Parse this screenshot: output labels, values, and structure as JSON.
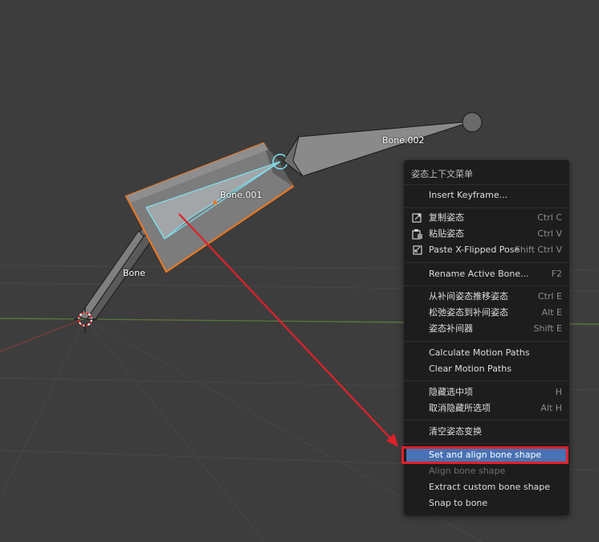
{
  "viewport": {
    "bones": [
      {
        "label": "Bone"
      },
      {
        "label": "Bone.001"
      },
      {
        "label": "Bone.002"
      }
    ]
  },
  "menu": {
    "title": "姿态上下文菜单",
    "items": [
      {
        "label": "Insert Keyframe...",
        "shortcut": "",
        "icon": ""
      },
      {
        "label": "复制姿态",
        "shortcut": "Ctrl C",
        "icon": "copy-pose-icon"
      },
      {
        "label": "粘贴姿态",
        "shortcut": "Ctrl V",
        "icon": "paste-pose-icon"
      },
      {
        "label": "Paste X-Flipped Pose",
        "shortcut": "Shift Ctrl V",
        "icon": "paste-flipped-pose-icon"
      },
      {
        "label": "Rename Active Bone...",
        "shortcut": "F2",
        "icon": ""
      },
      {
        "label": "从补间姿态推移姿态",
        "shortcut": "Ctrl E",
        "icon": ""
      },
      {
        "label": "松弛姿态到补间姿态",
        "shortcut": "Alt E",
        "icon": ""
      },
      {
        "label": "姿态补间器",
        "shortcut": "Shift E",
        "icon": ""
      },
      {
        "label": "Calculate Motion Paths",
        "shortcut": "",
        "icon": ""
      },
      {
        "label": "Clear Motion Paths",
        "shortcut": "",
        "icon": ""
      },
      {
        "label": "隐藏选中项",
        "shortcut": "H",
        "icon": ""
      },
      {
        "label": "取消隐藏所选项",
        "shortcut": "Alt H",
        "icon": ""
      },
      {
        "label": "清空姿态变换",
        "shortcut": "",
        "icon": ""
      },
      {
        "label": "Set and align bone shape",
        "shortcut": "",
        "icon": "",
        "highlighted": true
      },
      {
        "label": "Align bone shape",
        "shortcut": "",
        "icon": "",
        "disabled": true
      },
      {
        "label": "Extract custom bone shape",
        "shortcut": "",
        "icon": ""
      },
      {
        "label": "Snap to bone",
        "shortcut": "",
        "icon": ""
      }
    ]
  },
  "colors": {
    "background": "#3d3d3d",
    "menu_bg": "#1d1d1d",
    "highlight": "#4772b3",
    "annotation_red": "#e2202a",
    "selection_orange": "#f07820",
    "active_cyan": "#7ee0f0"
  }
}
